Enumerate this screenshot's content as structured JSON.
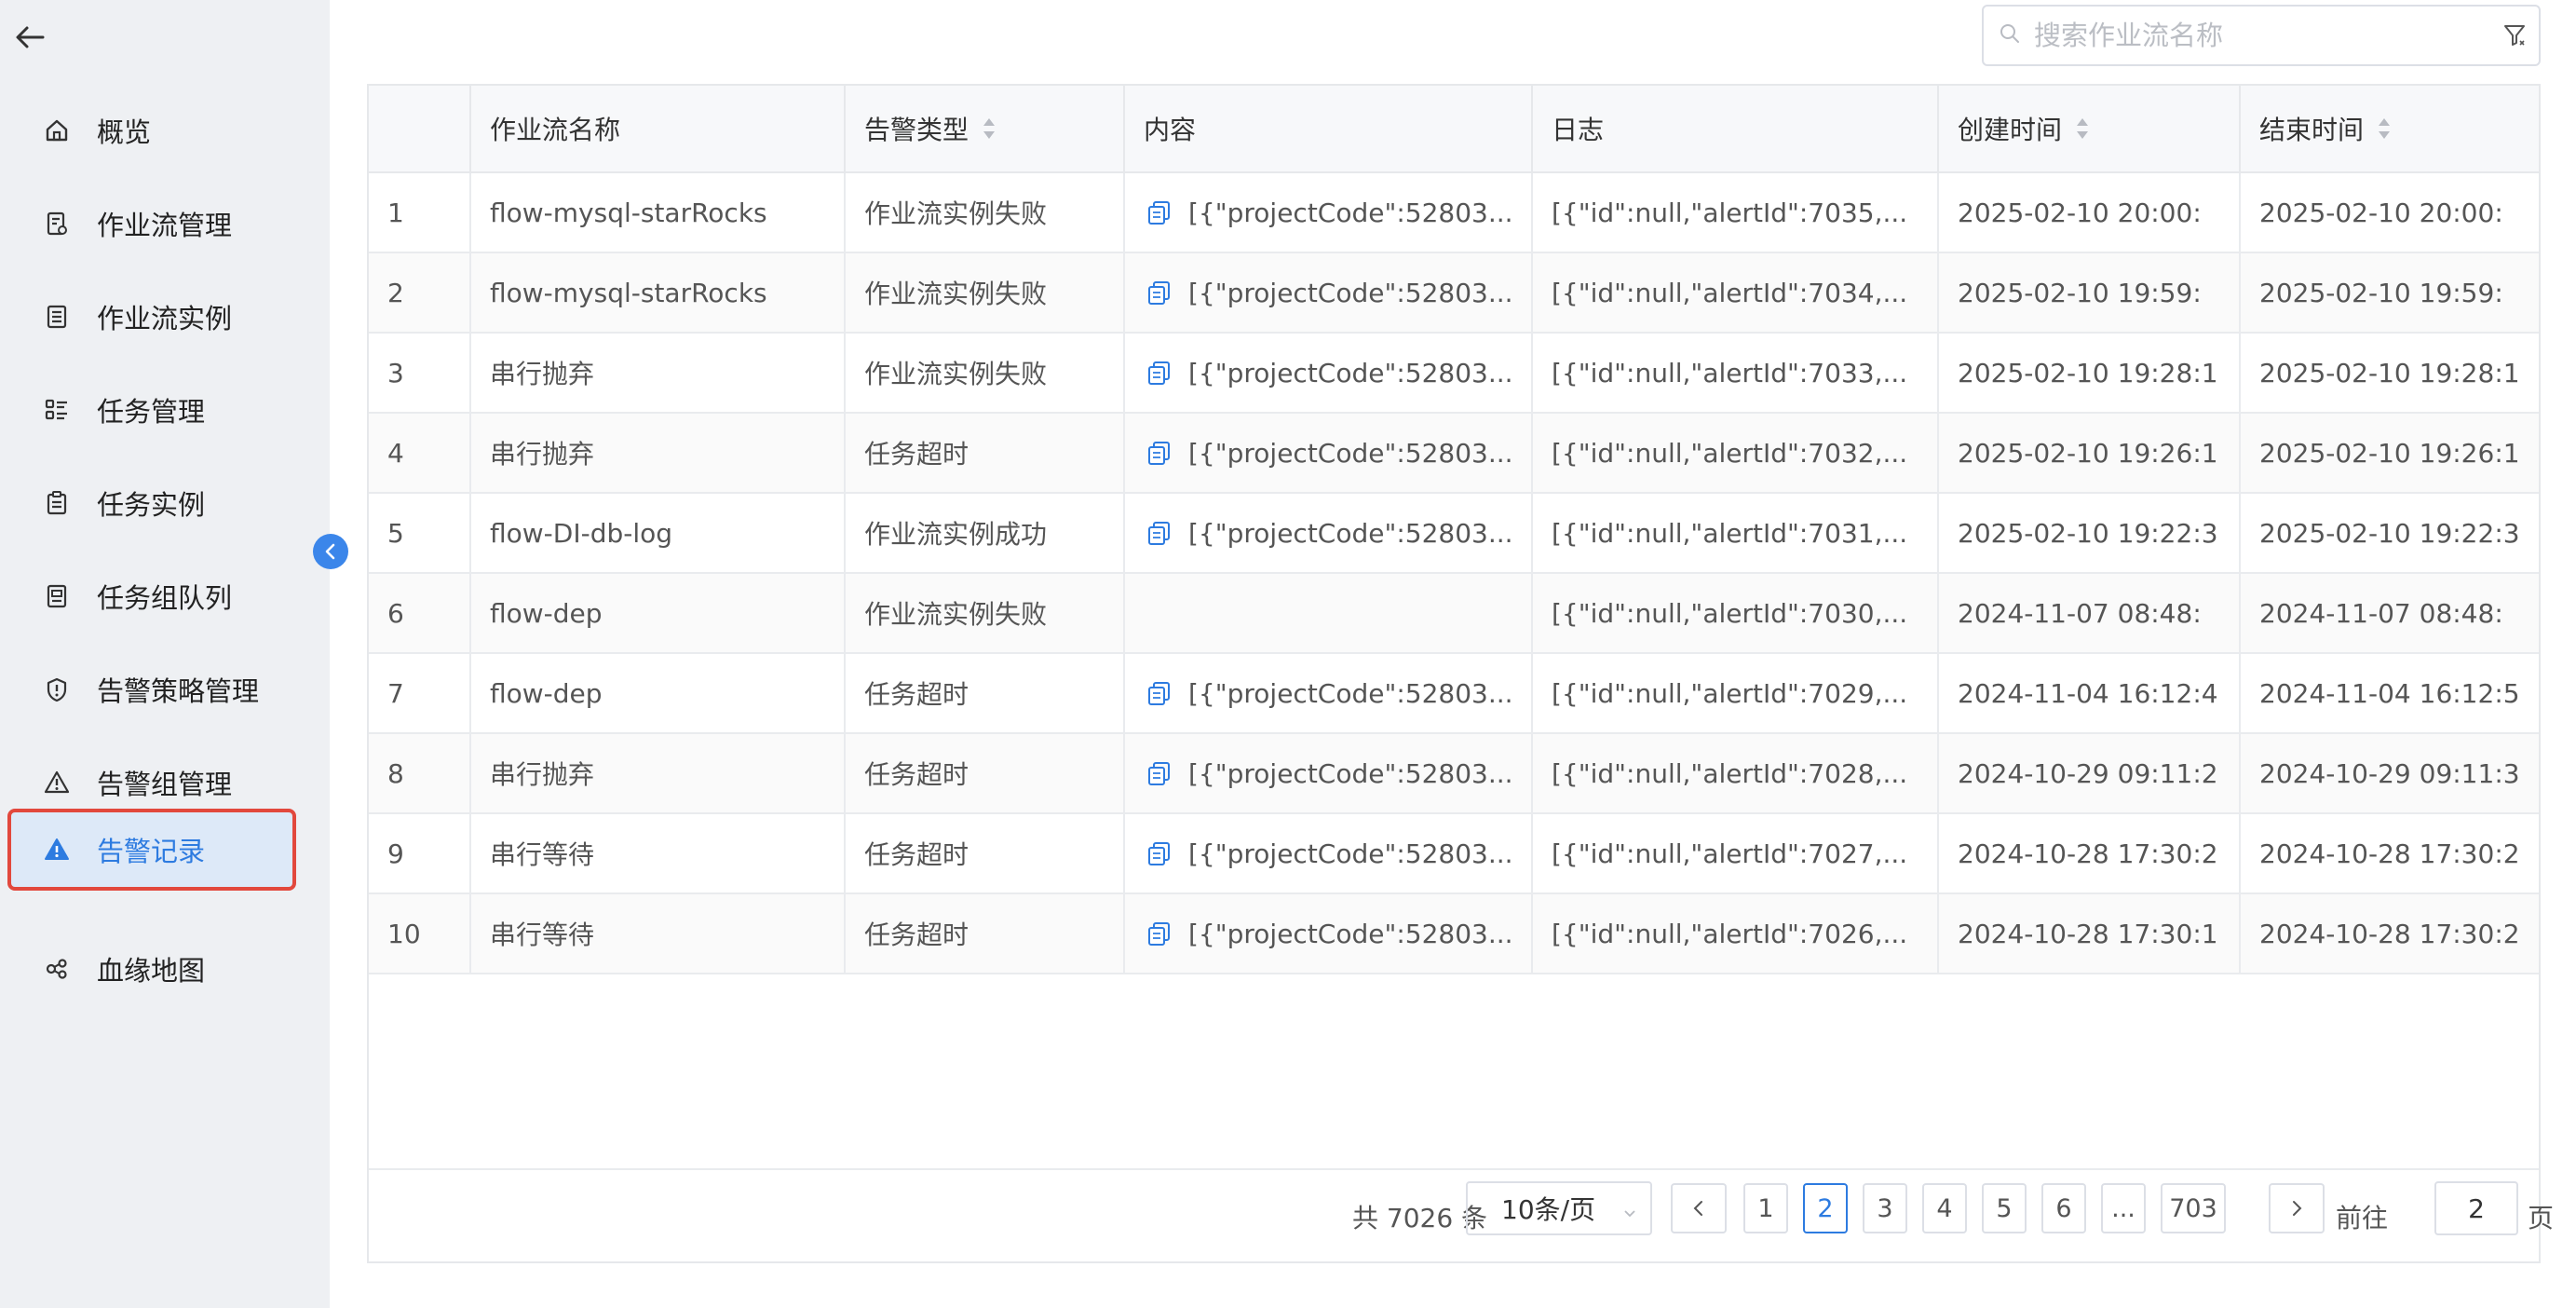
{
  "sidebar": {
    "items": [
      {
        "label": "概览",
        "icon": "home-icon"
      },
      {
        "label": "作业流管理",
        "icon": "workflow-doc-icon"
      },
      {
        "label": "作业流实例",
        "icon": "document-list-icon"
      },
      {
        "label": "任务管理",
        "icon": "task-list-icon"
      },
      {
        "label": "任务实例",
        "icon": "clipboard-icon"
      },
      {
        "label": "任务组队列",
        "icon": "queue-icon"
      },
      {
        "label": "告警策略管理",
        "icon": "shield-alert-icon"
      },
      {
        "label": "告警组管理",
        "icon": "warning-outline-icon"
      },
      {
        "label": "告警记录",
        "icon": "warning-filled-icon",
        "active": true
      },
      {
        "label": "血缘地图",
        "icon": "lineage-icon"
      }
    ]
  },
  "search": {
    "placeholder": "搜索作业流名称"
  },
  "table": {
    "headers": {
      "index": "",
      "flow_name": "作业流名称",
      "alert_type": "告警类型",
      "content": "内容",
      "log": "日志",
      "created": "创建时间",
      "ended": "结束时间"
    },
    "rows": [
      {
        "index": "1",
        "flow_name": "flow-mysql-starRocks",
        "alert_type": "作业流实例失败",
        "content": "[{\"projectCode\":52803...",
        "log": "[{\"id\":null,\"alertId\":7035,...",
        "created": "2025-02-10 20:00:",
        "ended": "2025-02-10 20:00:"
      },
      {
        "index": "2",
        "flow_name": "flow-mysql-starRocks",
        "alert_type": "作业流实例失败",
        "content": "[{\"projectCode\":52803...",
        "log": "[{\"id\":null,\"alertId\":7034,...",
        "created": "2025-02-10 19:59:",
        "ended": "2025-02-10 19:59:"
      },
      {
        "index": "3",
        "flow_name": "串行抛弃",
        "alert_type": "作业流实例失败",
        "content": "[{\"projectCode\":52803...",
        "log": "[{\"id\":null,\"alertId\":7033,...",
        "created": "2025-02-10 19:28:1",
        "ended": "2025-02-10 19:28:1"
      },
      {
        "index": "4",
        "flow_name": "串行抛弃",
        "alert_type": "任务超时",
        "content": "[{\"projectCode\":52803...",
        "log": "[{\"id\":null,\"alertId\":7032,...",
        "created": "2025-02-10 19:26:1",
        "ended": "2025-02-10 19:26:1"
      },
      {
        "index": "5",
        "flow_name": "flow-DI-db-log",
        "alert_type": "作业流实例成功",
        "content": "[{\"projectCode\":52803...",
        "log": "[{\"id\":null,\"alertId\":7031,...",
        "created": "2025-02-10 19:22:3",
        "ended": "2025-02-10 19:22:3"
      },
      {
        "index": "6",
        "flow_name": "flow-dep",
        "alert_type": "作业流实例失败",
        "content": "",
        "log": "[{\"id\":null,\"alertId\":7030,...",
        "created": "2024-11-07 08:48:",
        "ended": "2024-11-07 08:48:"
      },
      {
        "index": "7",
        "flow_name": "flow-dep",
        "alert_type": "任务超时",
        "content": "[{\"projectCode\":52803...",
        "log": "[{\"id\":null,\"alertId\":7029,...",
        "created": "2024-11-04 16:12:4",
        "ended": "2024-11-04 16:12:5"
      },
      {
        "index": "8",
        "flow_name": "串行抛弃",
        "alert_type": "任务超时",
        "content": "[{\"projectCode\":52803...",
        "log": "[{\"id\":null,\"alertId\":7028,...",
        "created": "2024-10-29 09:11:2",
        "ended": "2024-10-29 09:11:3"
      },
      {
        "index": "9",
        "flow_name": "串行等待",
        "alert_type": "任务超时",
        "content": "[{\"projectCode\":52803...",
        "log": "[{\"id\":null,\"alertId\":7027,...",
        "created": "2024-10-28 17:30:2",
        "ended": "2024-10-28 17:30:2"
      },
      {
        "index": "10",
        "flow_name": "串行等待",
        "alert_type": "任务超时",
        "content": "[{\"projectCode\":52803...",
        "log": "[{\"id\":null,\"alertId\":7026,...",
        "created": "2024-10-28 17:30:1",
        "ended": "2024-10-28 17:30:2"
      }
    ]
  },
  "pagination": {
    "total_text": "共 7026 条",
    "page_size": "10条/页",
    "pages": [
      "1",
      "2",
      "3",
      "4",
      "5",
      "6",
      "...",
      "703"
    ],
    "current_page": "2",
    "goto_label": "前往",
    "goto_value": "2",
    "page_suffix": "页"
  },
  "colors": {
    "accent": "#2d7be0",
    "highlight_border": "#e2483d",
    "active_bg": "#dde9f8"
  }
}
